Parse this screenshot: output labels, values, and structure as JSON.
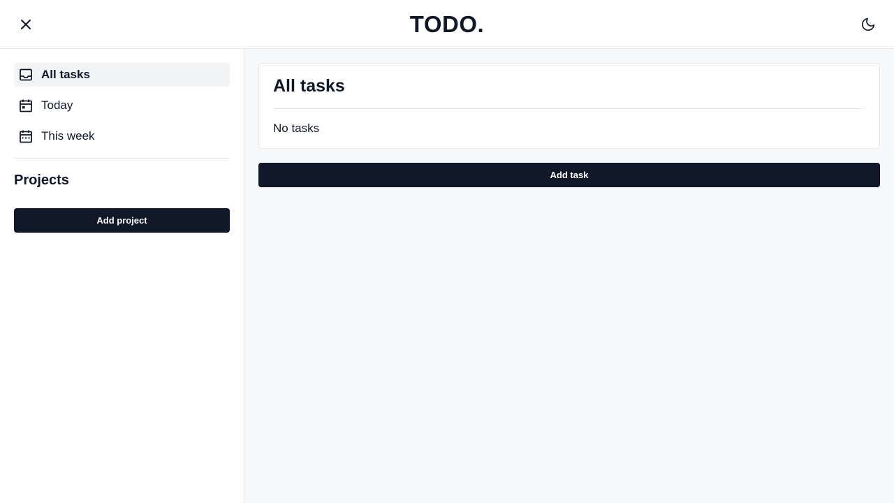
{
  "app": {
    "title": "TODO.",
    "close_icon": "close-icon",
    "theme_icon": "moon-icon"
  },
  "sidebar": {
    "items": [
      {
        "label": "All tasks",
        "icon": "inbox-icon",
        "active": true
      },
      {
        "label": "Today",
        "icon": "calendar-day-icon",
        "active": false
      },
      {
        "label": "This week",
        "icon": "calendar-week-icon",
        "active": false
      }
    ],
    "projects_title": "Projects",
    "add_project_label": "Add project"
  },
  "main": {
    "title": "All tasks",
    "empty_text": "No tasks",
    "add_task_label": "Add task"
  },
  "colors": {
    "primary": "#111827",
    "active_bg": "#f3f4f6",
    "main_bg": "#f8f9fb",
    "border": "#e5e7eb"
  }
}
